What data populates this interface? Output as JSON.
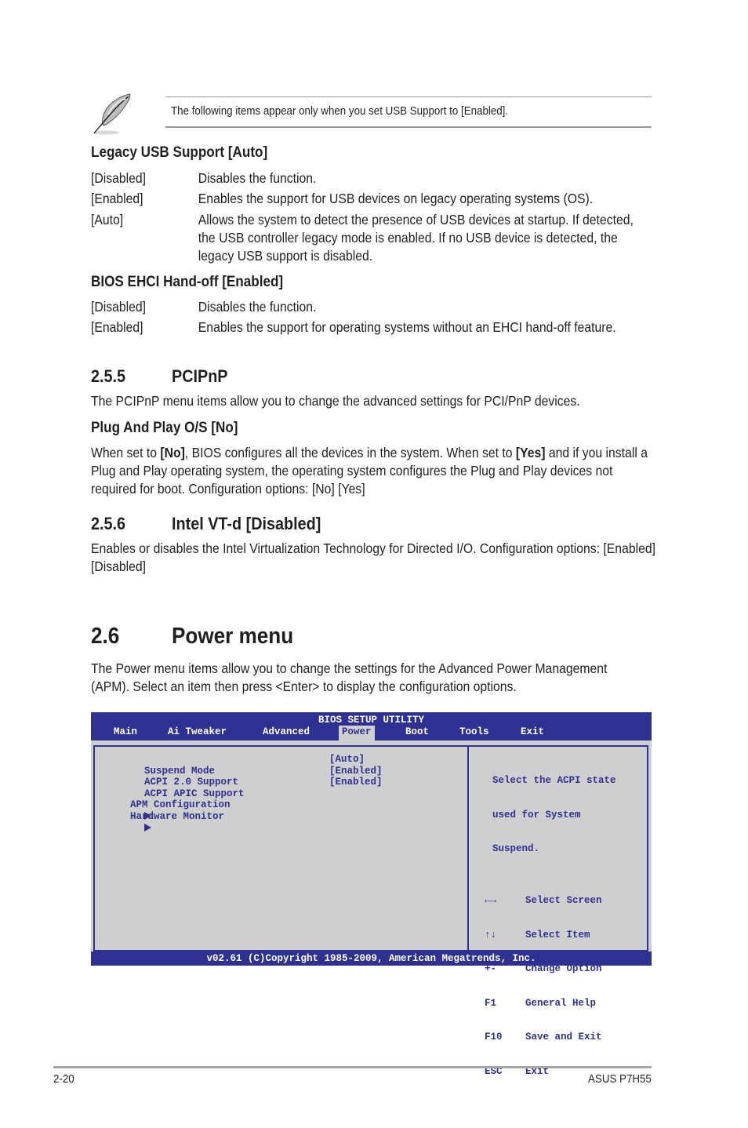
{
  "note": {
    "icon": "feather-pen-icon",
    "text": "The following items appear only when you set USB Support to [Enabled]."
  },
  "legacy_usb": {
    "heading": "Legacy USB Support [Auto]",
    "options": [
      {
        "name": "[Disabled]",
        "desc": "Disables the function."
      },
      {
        "name": "[Enabled]",
        "desc": "Enables the support for USB devices on legacy operating systems (OS)."
      },
      {
        "name": "[Auto]",
        "desc": "Allows the system to detect the presence of USB devices at startup. If detected, the USB controller legacy mode is enabled. If no USB device is detected, the legacy USB support is disabled."
      }
    ]
  },
  "ehci": {
    "heading": "BIOS EHCI Hand-off [Enabled]",
    "options": [
      {
        "name": "[Disabled]",
        "desc": "Disables the function."
      },
      {
        "name": "[Enabled]",
        "desc": "Enables the support for operating systems without an EHCI hand-off feature."
      }
    ]
  },
  "pcipnp": {
    "number": "2.5.5",
    "title": "PCIPnP",
    "intro": "The PCIPnP menu items allow you to change the advanced settings for PCI/PnP devices.",
    "sub_heading": "Plug And Play O/S [No]",
    "para_part1": "When set to ",
    "para_bold1": "[No]",
    "para_part2": ", BIOS configures all the devices in the system. When set to ",
    "para_bold2": "[Yes]",
    "para_part3": " and if you install a Plug and Play operating system, the operating system configures the Plug and Play devices not required for boot. Configuration options: [No] [Yes]"
  },
  "vtd": {
    "number": "2.5.6",
    "title": "Intel VT-d [Disabled]",
    "text": "Enables or disables the Intel Virtualization Technology for Directed I/O. Configuration options: [Enabled] [Disabled]"
  },
  "power": {
    "number": "2.6",
    "title": "Power menu",
    "intro": "The Power menu items allow you to change the settings for the Advanced Power Management (APM). Select an item then press <Enter> to display the configuration options."
  },
  "bios": {
    "title": "BIOS SETUP UTILITY",
    "tabs": [
      {
        "label": "Main"
      },
      {
        "label": "Ai Tweaker"
      },
      {
        "label": "Advanced"
      },
      {
        "label": "Power",
        "active": true
      },
      {
        "label": "Boot"
      },
      {
        "label": "Tools"
      },
      {
        "label": "Exit"
      }
    ],
    "settings": [
      {
        "label": "Suspend Mode",
        "value": "[Auto]"
      },
      {
        "label": "ACPI 2.0 Support",
        "value": "[Enabled]"
      },
      {
        "label": "ACPI APIC Support",
        "value": "[Enabled]"
      }
    ],
    "submenus": [
      {
        "label": "APM Configuration"
      },
      {
        "label": "Hardware Monitor"
      }
    ],
    "help_lines": [
      "Select the ACPI state",
      "used for System",
      "Suspend."
    ],
    "keys": [
      {
        "key": "←→",
        "action": "Select Screen"
      },
      {
        "key": "↑↓",
        "action": "Select Item"
      },
      {
        "key": "+-",
        "action": "Change Option"
      },
      {
        "key": "F1",
        "action": "General Help"
      },
      {
        "key": "F10",
        "action": "Save and Exit"
      },
      {
        "key": "ESC",
        "action": "Exit"
      }
    ],
    "footer": "v02.61 (C)Copyright 1985-2009, American Megatrends, Inc.",
    "colors": {
      "blue": "#2e3192",
      "gray": "#cfcfcf"
    }
  },
  "page_footer": {
    "page_number": "2-20",
    "model": "ASUS P7H55"
  }
}
